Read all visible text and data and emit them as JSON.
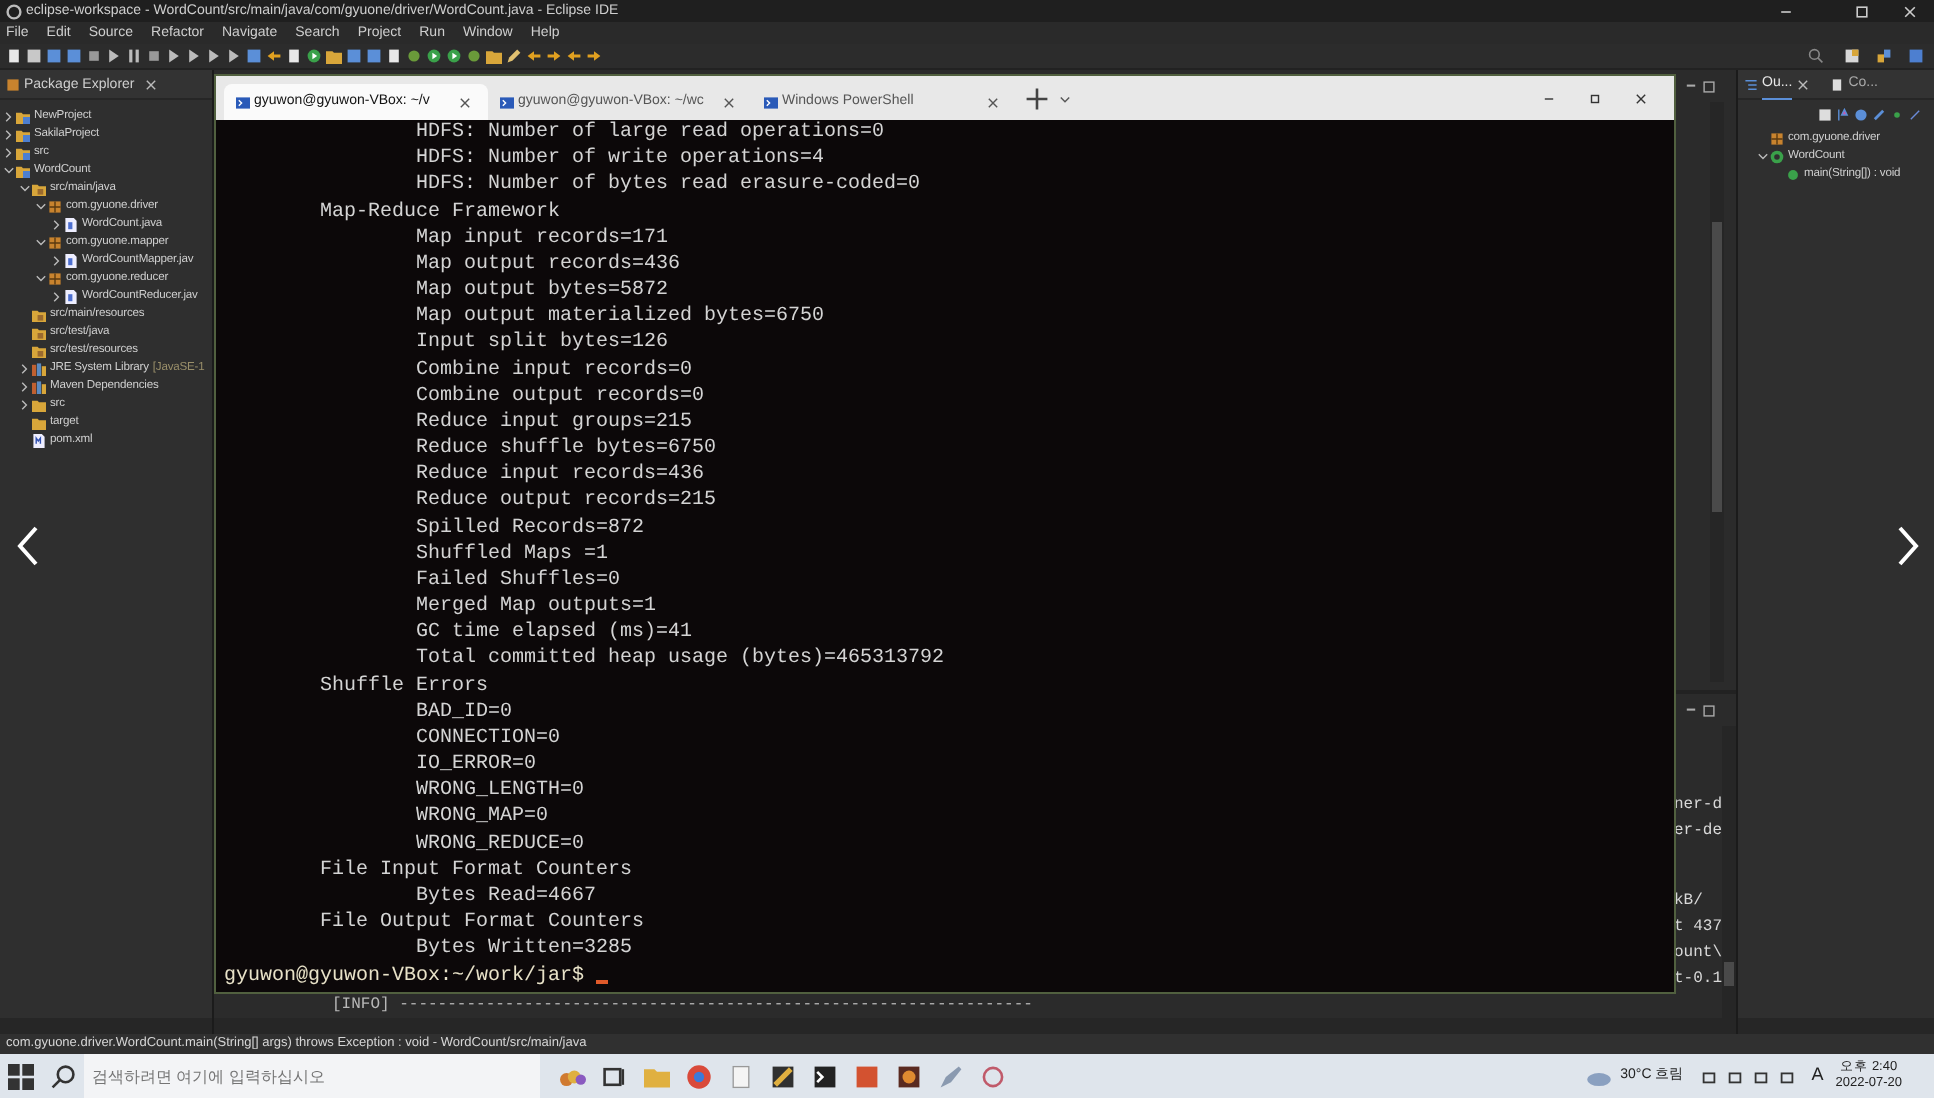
{
  "window": {
    "title": "eclipse-workspace - WordCount/src/main/java/com/gyuone/driver/WordCount.java - Eclipse IDE"
  },
  "menu": [
    "File",
    "Edit",
    "Source",
    "Refactor",
    "Navigate",
    "Search",
    "Project",
    "Run",
    "Window",
    "Help"
  ],
  "package_explorer": {
    "title": "Package Explorer",
    "tree": [
      {
        "label": "NewProject",
        "kind": "project",
        "expanded": false
      },
      {
        "label": "SakilaProject",
        "kind": "project",
        "expanded": false
      },
      {
        "label": "src",
        "kind": "project",
        "expanded": false
      },
      {
        "label": "WordCount",
        "kind": "project",
        "expanded": true,
        "children": [
          {
            "label": "src/main/java",
            "kind": "source-folder",
            "expanded": true,
            "children": [
              {
                "label": "com.gyuone.driver",
                "kind": "package",
                "expanded": true,
                "children": [
                  {
                    "label": "WordCount.java",
                    "kind": "java",
                    "expanded": false
                  }
                ]
              },
              {
                "label": "com.gyuone.mapper",
                "kind": "package",
                "expanded": true,
                "children": [
                  {
                    "label": "WordCountMapper.jav",
                    "kind": "java",
                    "expanded": false
                  }
                ]
              },
              {
                "label": "com.gyuone.reducer",
                "kind": "package",
                "expanded": true,
                "children": [
                  {
                    "label": "WordCountReducer.jav",
                    "kind": "java",
                    "expanded": false
                  }
                ]
              }
            ]
          },
          {
            "label": "src/main/resources",
            "kind": "source-folder"
          },
          {
            "label": "src/test/java",
            "kind": "source-folder"
          },
          {
            "label": "src/test/resources",
            "kind": "source-folder"
          },
          {
            "label": "JRE System Library",
            "decoration": "[JavaSE-1",
            "kind": "library",
            "expanded": false
          },
          {
            "label": "Maven Dependencies",
            "kind": "library",
            "expanded": false
          },
          {
            "label": "src",
            "kind": "folder",
            "expanded": false
          },
          {
            "label": "target",
            "kind": "folder"
          },
          {
            "label": "pom.xml",
            "kind": "xml"
          }
        ]
      }
    ]
  },
  "outline": {
    "tabs": [
      {
        "label": "Ou...",
        "selected": true
      },
      {
        "label": "Co...",
        "selected": false
      }
    ],
    "tree": [
      {
        "label": "com.gyuone.driver",
        "kind": "package"
      },
      {
        "label": "WordCount",
        "kind": "class",
        "expanded": true,
        "children": [
          {
            "label": "main(String[]) : void",
            "kind": "method"
          }
        ]
      }
    ]
  },
  "terminal": {
    "tabs": [
      {
        "label": "gyuwon@gyuwon-VBox: ~/v",
        "selected": true
      },
      {
        "label": "gyuwon@gyuwon-VBox: ~/wc",
        "selected": false
      },
      {
        "label": "Windows PowerShell",
        "selected": false
      }
    ],
    "output": [
      {
        "children": [
          "HDFS: Number of large read operations=0",
          "HDFS: Number of write operations=4",
          "HDFS: Number of bytes read erasure-coded=0"
        ]
      },
      {
        "text": "Map-Reduce Framework",
        "children": [
          "Map input records=171",
          "Map output records=436",
          "Map output bytes=5872",
          "Map output materialized bytes=6750",
          "Input split bytes=126",
          "Combine input records=0",
          "Combine output records=0",
          "Reduce input groups=215",
          "Reduce shuffle bytes=6750",
          "Reduce input records=436",
          "Reduce output records=215",
          "Spilled Records=872",
          "Shuffled Maps =1",
          "Failed Shuffles=0",
          "Merged Map outputs=1",
          "GC time elapsed (ms)=41",
          "Total committed heap usage (bytes)=465313792"
        ]
      },
      {
        "text": "Shuffle Errors",
        "children": [
          "BAD_ID=0",
          "CONNECTION=0",
          "IO_ERROR=0",
          "WRONG_LENGTH=0",
          "WRONG_MAP=0",
          "WRONG_REDUCE=0"
        ]
      },
      {
        "text": "File Input Format Counters",
        "children": [
          "Bytes Read=4667"
        ]
      },
      {
        "text": "File Output Format Counters",
        "children": [
          "Bytes Written=3285"
        ]
      }
    ],
    "prompt": "gyuwon@gyuwon-VBox:~/work/jar$"
  },
  "console": {
    "fragment_groups": [
      [
        "ner-d",
        "er-de"
      ],
      [
        "kB/",
        "t 437",
        "ount\\",
        "t-0.1"
      ]
    ],
    "last_line": "[INFO] ------------------------------------------------------------------"
  },
  "status_bar": "com.gyuone.driver.WordCount.main(String[] args) throws Exception : void - WordCount/src/main/java",
  "taskbar": {
    "search_placeholder": "검색하려면 여기에 입력하십시오",
    "weather": "30°C 흐림",
    "input_indicator": "A",
    "time": "오후 2:40",
    "date": "2022-07-20"
  }
}
